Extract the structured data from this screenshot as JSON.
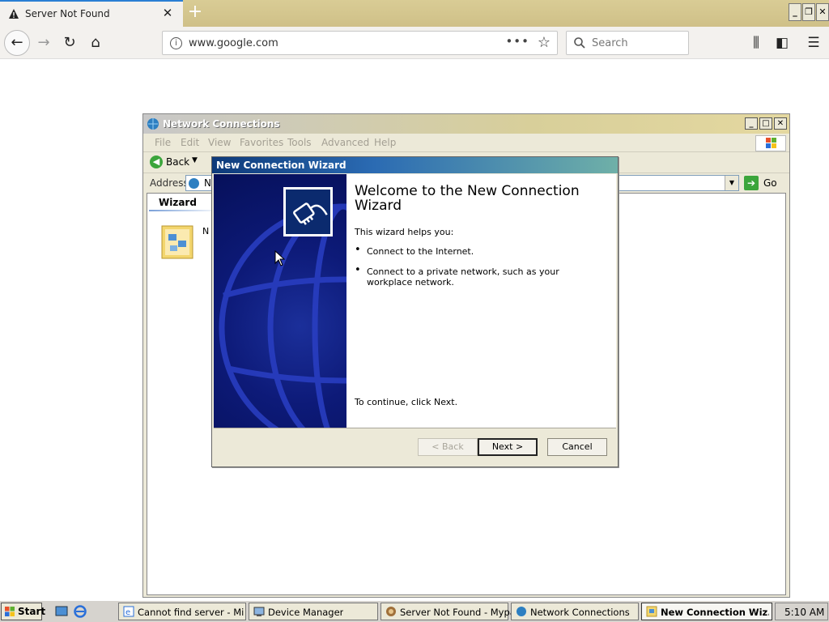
{
  "browser": {
    "tab_title": "Server Not Found",
    "url": "www.google.com",
    "search_placeholder": "Search"
  },
  "network_connections": {
    "title": "Network Connections",
    "menu": [
      "File",
      "Edit",
      "View",
      "Favorites",
      "Tools",
      "Advanced",
      "Help"
    ],
    "back_label": "Back",
    "address_label": "Address",
    "address_value": "Ne",
    "go_label": "Go",
    "group_header": "Wizard",
    "icon_label": "N"
  },
  "wizard": {
    "title": "New Connection Wizard",
    "heading": "Welcome to the New Connection Wizard",
    "intro": "This wizard helps you:",
    "bullets": [
      "Connect to the Internet.",
      "Connect to a private network, such as your workplace network."
    ],
    "continue_text": "To continue, click Next.",
    "buttons": {
      "back": "< Back",
      "next": "Next >",
      "cancel": "Cancel"
    }
  },
  "taskbar": {
    "start_label": "Start",
    "items": [
      "Cannot find server - Micro...",
      "Device Manager",
      "Server Not Found - Mypal",
      "Network Connections",
      "New Connection Wiz..."
    ],
    "clock": "5:10 AM"
  },
  "colors": {
    "wizard_title_start": "#0e3a7a",
    "wizard_panel": "#0d1a78",
    "xp_face": "#ece9d8"
  }
}
